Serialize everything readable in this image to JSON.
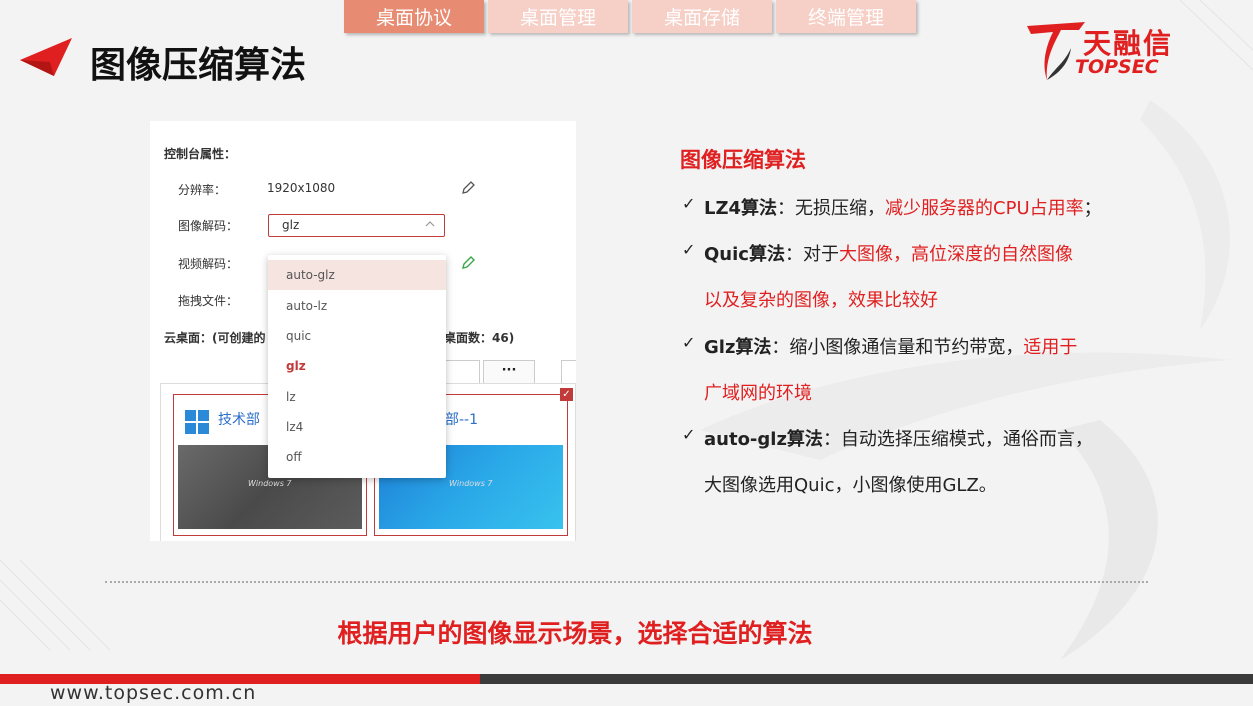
{
  "tabs": [
    {
      "label": "桌面协议",
      "active": true
    },
    {
      "label": "桌面管理",
      "active": false
    },
    {
      "label": "桌面存储",
      "active": false
    },
    {
      "label": "终端管理",
      "active": false
    }
  ],
  "page_title": "图像压缩算法",
  "logo": {
    "cn": "天融信",
    "en": "TOPSEC"
  },
  "panel": {
    "section_header": "控制台属性：",
    "resolution_label": "分辨率：",
    "resolution_value": "1920x1080",
    "image_codec_label": "图像解码：",
    "image_codec_value": "glz",
    "video_codec_label": "视频解码：",
    "drag_file_label": "拖拽文件：",
    "cloud_desktop_label": "云桌面：(可创建的",
    "cloud_desktop_count": "桌面数：46)",
    "more_button": "···",
    "dropdown_options": [
      "auto-glz",
      "auto-lz",
      "quic",
      "glz",
      "lz",
      "lz4",
      "off"
    ],
    "dropdown_hover": "auto-glz",
    "dropdown_selected": "glz",
    "desktops": [
      {
        "title": "技术部",
        "thumb_caption": "Windows 7"
      },
      {
        "title": "术部--1",
        "thumb_caption": "Windows 7"
      }
    ]
  },
  "right": {
    "title": "图像压缩算法",
    "bullets": [
      {
        "name": "LZ4算法",
        "parts": [
          {
            "text": "：无损压缩，",
            "red": false
          },
          {
            "text": "减少服务器的CPU占用率",
            "red": true
          },
          {
            "text": "；",
            "red": false
          }
        ]
      },
      {
        "name": "Quic算法",
        "parts": [
          {
            "text": "：对于",
            "red": false
          },
          {
            "text": "大图像，高位深度的自然图像",
            "red": true
          }
        ],
        "cont": "以及复杂的图像，效果比较好",
        "cont_red": true
      },
      {
        "name": "Glz算法",
        "parts": [
          {
            "text": "：缩小图像通信量和节约带宽，",
            "red": false
          },
          {
            "text": "适用于",
            "red": true
          }
        ],
        "cont": "广域网的环境",
        "cont_red": true
      },
      {
        "name": "auto-glz算法",
        "parts": [
          {
            "text": "：自动选择压缩模式，通俗而言，",
            "red": false
          }
        ],
        "cont": "大图像选用Quic，小图像使用GLZ。",
        "cont_red": false
      }
    ]
  },
  "conclusion": "根据用户的图像显示场景，选择合适的算法",
  "footer_url": "www.topsec.com.cn",
  "colors": {
    "accent": "#e02020",
    "tab_active": "#e88b73",
    "tab_inactive": "#f6cfc6"
  }
}
